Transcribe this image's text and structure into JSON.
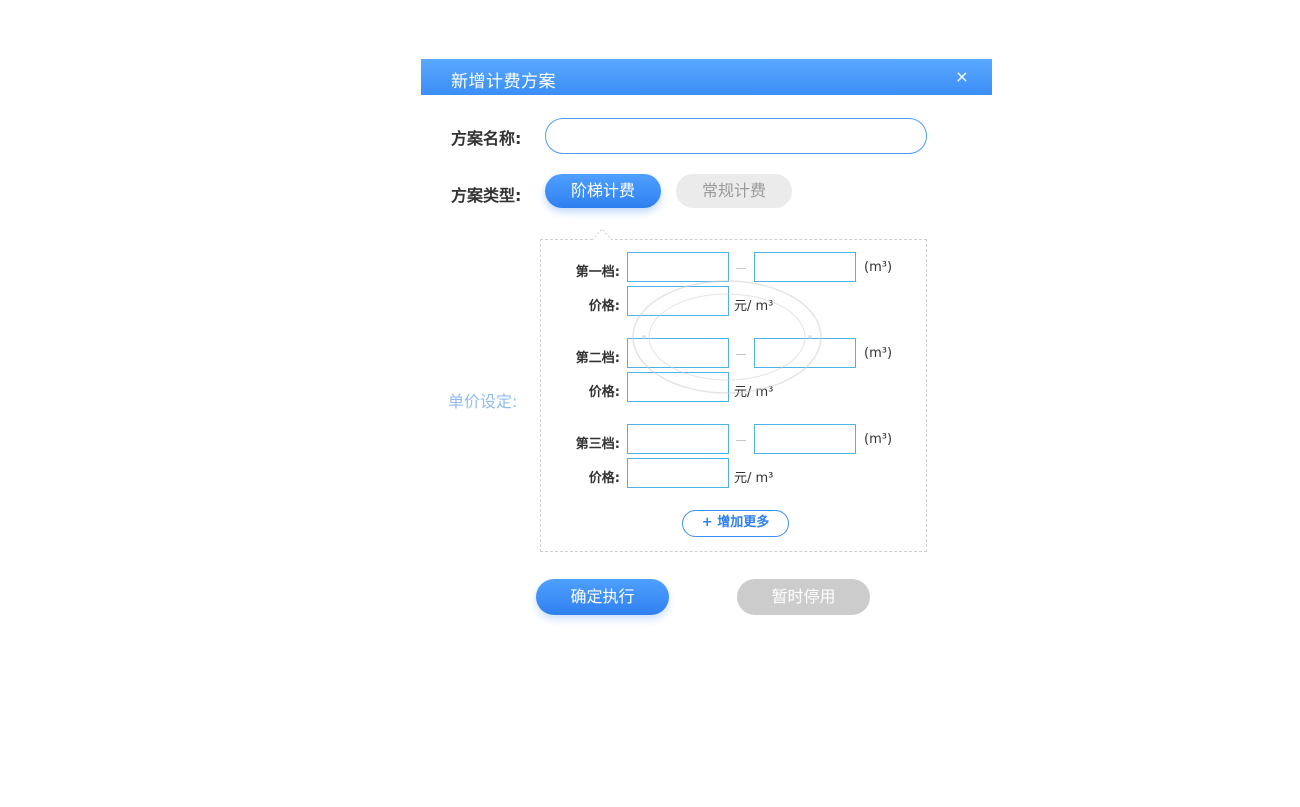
{
  "dialog": {
    "title": "新增计费方案",
    "close_glyph": "×"
  },
  "form": {
    "name_label": "方案名称:",
    "name_value": "",
    "type_label": "方案类型:",
    "type_options": [
      {
        "label": "阶梯计费",
        "selected": true
      },
      {
        "label": "常规计费",
        "selected": false
      }
    ],
    "unit_price_label": "单价设定:"
  },
  "tiers": [
    {
      "label": "第一档:",
      "range_unit": "(m³)",
      "price_label": "价格:",
      "price_unit": "元/ m³",
      "from": "",
      "to": "",
      "price": ""
    },
    {
      "label": "第二档:",
      "range_unit": "(m³)",
      "price_label": "价格:",
      "price_unit": "元/ m³",
      "from": "",
      "to": "",
      "price": ""
    },
    {
      "label": "第三档:",
      "range_unit": "(m³)",
      "price_label": "价格:",
      "price_unit": "元/ m³",
      "from": "",
      "to": "",
      "price": ""
    }
  ],
  "add_more_label": "+ 增加更多",
  "actions": {
    "confirm": "确定执行",
    "disable": "暂时停用"
  },
  "watermark": {
    "main": "湖南集社",
    "top": "www.jisheyun.cn",
    "bottom": "版权所有，侵权必究"
  },
  "colors": {
    "primary": "#2f80f0",
    "title_bar": "#4d9cf5",
    "input_border": "#4cb3e8",
    "disabled": "#cccccc",
    "unit_label": "#8fbdf0"
  }
}
